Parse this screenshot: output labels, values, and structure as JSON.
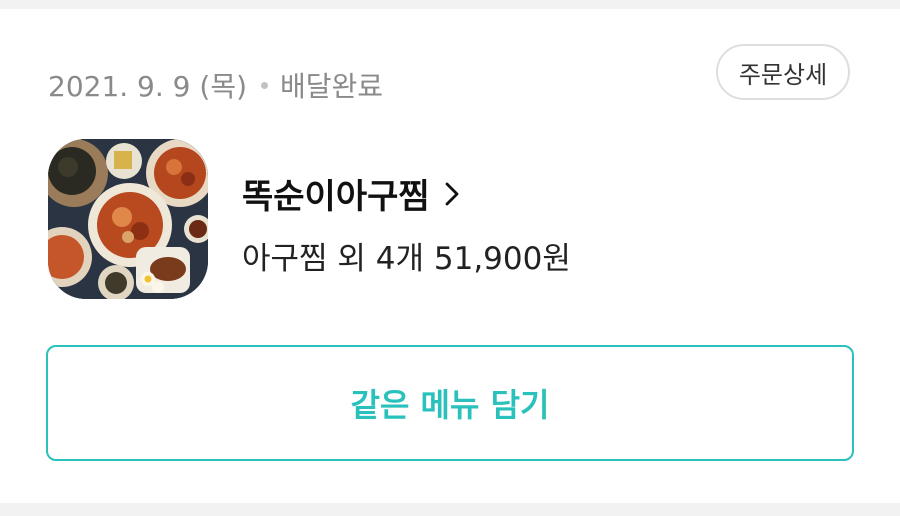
{
  "order": {
    "date": "2021. 9. 9 (목)",
    "status": "배달완료",
    "detail_button": "주문상세",
    "store_name": "똑순이아구찜",
    "summary": "아구찜 외 4개 51,900원",
    "reorder_button": "같은 메뉴 담기"
  },
  "icons": {
    "separator": "dot-icon",
    "store_link": "chevron-right-icon",
    "thumbnail": "food-thumbnail"
  },
  "colors": {
    "accent": "#2ac1bc",
    "meta_text": "#8a8a8a",
    "border": "#dedede"
  }
}
